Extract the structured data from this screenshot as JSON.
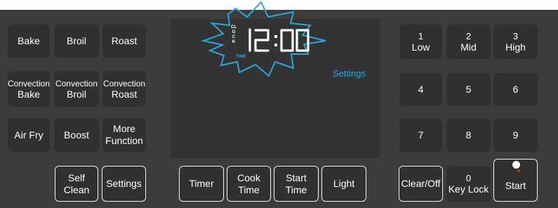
{
  "display": {
    "time": "12:00",
    "clock_label": "CLOCK",
    "time_label": "TIME",
    "settings_label": "Settings",
    "accent_color": "#2ea6dd"
  },
  "left_keys": {
    "bake": [
      "Bake"
    ],
    "broil": [
      "Broil"
    ],
    "roast": [
      "Roast"
    ],
    "convection_bake": [
      "Convection",
      "Bake"
    ],
    "convection_broil": [
      "Convection",
      "Broil"
    ],
    "convection_roast": [
      "Convection",
      "Roast"
    ],
    "air_fry": [
      "Air Fry"
    ],
    "boost": [
      "Boost"
    ],
    "more_function": [
      "More",
      "Function"
    ],
    "self_clean": [
      "Self",
      "Clean"
    ],
    "settings": [
      "Settings"
    ]
  },
  "center_keys": {
    "timer": [
      "Timer"
    ],
    "cook_time": [
      "Cook",
      "Time"
    ],
    "start_time": [
      "Start",
      "Time"
    ],
    "light": [
      "Light"
    ]
  },
  "keypad": {
    "k1": [
      "1",
      "Low"
    ],
    "k2": [
      "2",
      "Mid"
    ],
    "k3": [
      "3",
      "High"
    ],
    "k4": [
      "4"
    ],
    "k5": [
      "5"
    ],
    "k6": [
      "6"
    ],
    "k7": [
      "7"
    ],
    "k8": [
      "8"
    ],
    "k9": [
      "9"
    ],
    "clear_off": [
      "Clear/Off"
    ],
    "k0": [
      "0",
      "Key Lock"
    ],
    "start": [
      "Start"
    ]
  }
}
